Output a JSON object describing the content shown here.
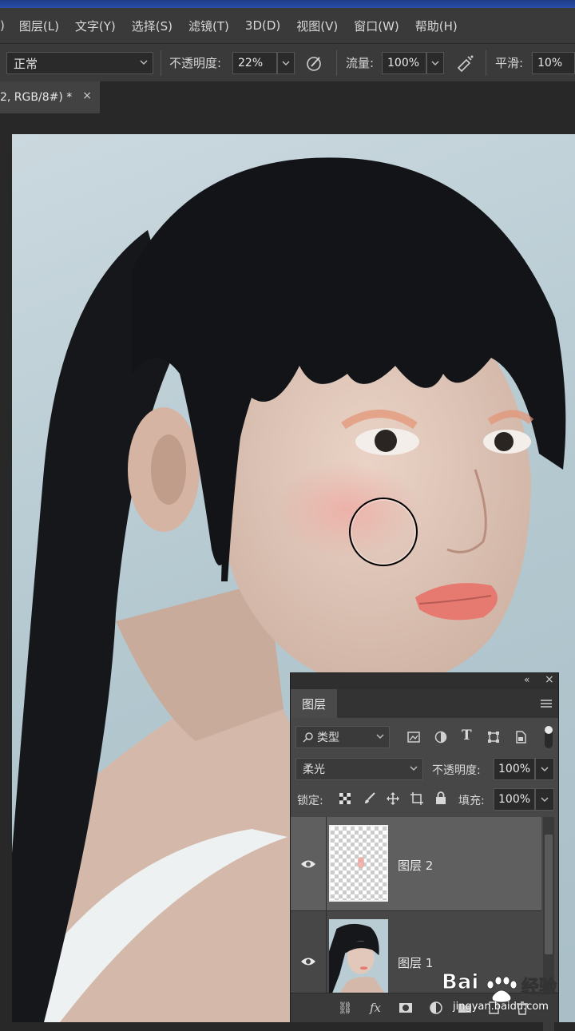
{
  "menu": [
    "图层(L)",
    "文字(Y)",
    "选择(S)",
    "滤镜(T)",
    "3D(D)",
    "视图(V)",
    "窗口(W)",
    "帮助(H)"
  ],
  "options": {
    "mode": "正常",
    "opacity_label": "不透明度:",
    "opacity_value": "22%",
    "flow_label": "流量:",
    "flow_value": "100%",
    "smooth_label": "平滑:",
    "smooth_value": "10%"
  },
  "document_tab": {
    "title": "2, RGB/8#) *",
    "close": "×"
  },
  "layers_panel": {
    "tab": "图层",
    "filter_kind": "类型",
    "blend_mode": "柔光",
    "opacity_label": "不透明度:",
    "opacity_value": "100%",
    "lock_label": "锁定:",
    "fill_label": "填充:",
    "fill_value": "100%",
    "layers": [
      {
        "name": "图层 2",
        "selected": true,
        "visible": true
      },
      {
        "name": "图层 1",
        "selected": false,
        "visible": true
      }
    ]
  },
  "watermark": {
    "brand": "Bai",
    "brand2": "经验",
    "url": "jingyan.baidu.com"
  }
}
